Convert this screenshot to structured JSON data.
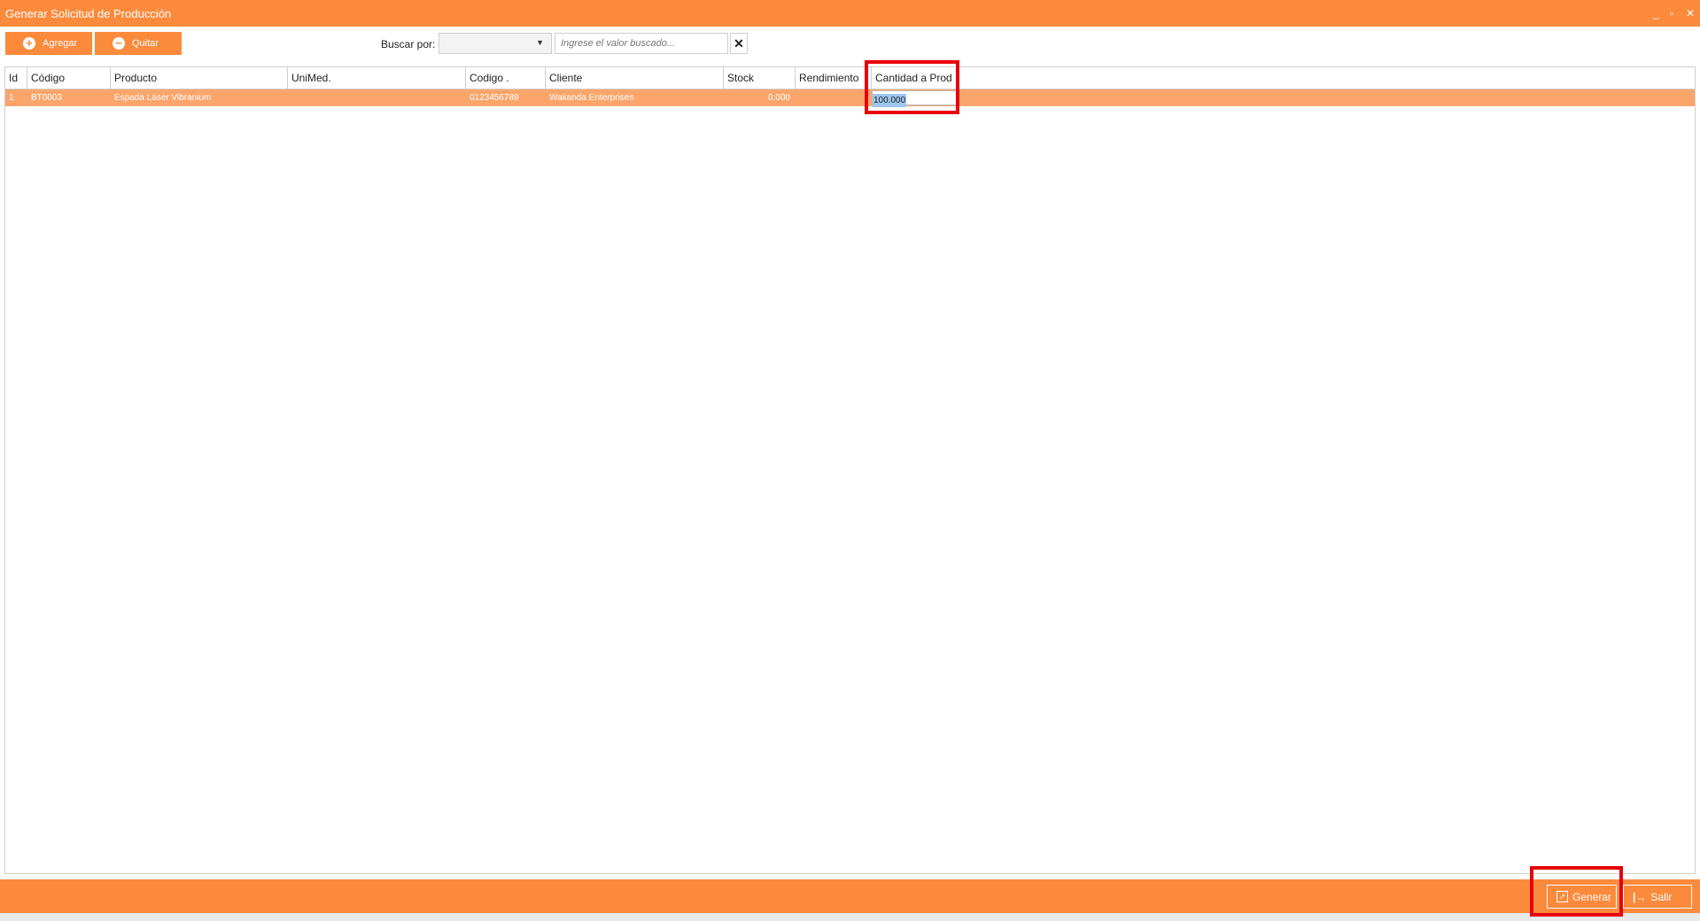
{
  "window": {
    "title": "Generar Solicitud de Producción",
    "controls": {
      "minimize": "_",
      "restore": "▫",
      "close": "✕"
    }
  },
  "toolbar": {
    "add_label": "Agregar",
    "remove_label": "Quitar",
    "search_label": "Buscar por:",
    "search_select_value": "",
    "search_placeholder": "Ingrese el valor buscado...",
    "clear_symbol": "✕"
  },
  "grid": {
    "columns": [
      "Id",
      "Código",
      "Producto",
      "UniMed.",
      "Codigo .",
      "Cliente",
      "Stock",
      "Rendimiento",
      "Cantidad a Prod"
    ],
    "rows": [
      {
        "id": "1",
        "codigo": "BT0003",
        "producto": "Espada Láser Vibranium",
        "unimed": "",
        "codigo2": "0123456789",
        "cliente": "Wakanda Enterprises",
        "stock": "0.000",
        "rendimiento": "",
        "cantidad": "100.000"
      }
    ]
  },
  "footer": {
    "generate_label": "Generar",
    "exit_label": "Salir"
  },
  "colors": {
    "accent": "#fb8a3c",
    "row_selected": "#fba56b",
    "highlight": "#e8000b"
  }
}
